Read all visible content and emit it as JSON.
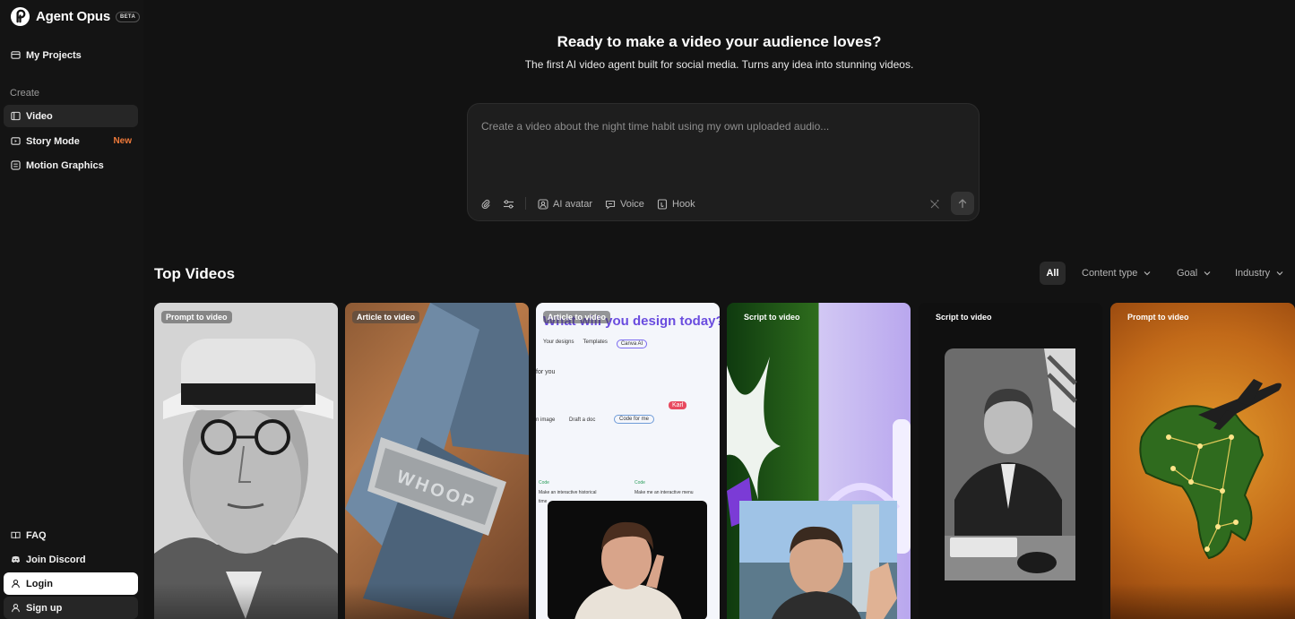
{
  "app": {
    "name": "Agent Opus",
    "beta_badge": "BETA"
  },
  "sidebar": {
    "my_projects": "My Projects",
    "section_create": "Create",
    "items": [
      {
        "label": "Video",
        "icon": "video-icon"
      },
      {
        "label": "Story Mode",
        "icon": "story-icon",
        "badge": "New"
      },
      {
        "label": "Motion Graphics",
        "icon": "motion-graphics-icon"
      }
    ],
    "bottom": [
      {
        "label": "FAQ",
        "icon": "book-icon"
      },
      {
        "label": "Join Discord",
        "icon": "discord-icon"
      },
      {
        "label": "Login",
        "icon": "user-icon"
      },
      {
        "label": "Sign up",
        "icon": "user-icon"
      }
    ]
  },
  "hero": {
    "title": "Ready to make a video your audience loves?",
    "subtitle": "The first AI video agent built for social media. Turns any idea into stunning videos."
  },
  "prompt": {
    "placeholder": "Create a video about the night time habit using my own uploaded audio...",
    "tools": {
      "ai_avatar": "AI avatar",
      "voice": "Voice",
      "hook": "Hook"
    }
  },
  "top_videos": {
    "title": "Top Videos",
    "filters": {
      "all": "All",
      "content_type": "Content type",
      "goal": "Goal",
      "industry": "Industry"
    },
    "cards": [
      {
        "tag": "Prompt to video"
      },
      {
        "tag": "Article to video",
        "brand_text": "WHOOP"
      },
      {
        "tag": "Article to video",
        "headline": "What will you design today?",
        "chips": [
          "Your designs",
          "Templates",
          "Canva AI"
        ],
        "label_for_you": "for you",
        "label_image": "n image",
        "label_doc": "Draft a doc",
        "label_code": "Code for me",
        "cursor_name": "Karl",
        "code_title": "Code",
        "code_1": "Make an interactive historical",
        "code_2": "Make me an interactive menu",
        "code_3": "time"
      },
      {
        "tag": "Script to video"
      },
      {
        "tag": "Script to video"
      },
      {
        "tag": "Prompt to video"
      }
    ]
  },
  "colors": {
    "background": "#121212",
    "accent_new": "#f07a3a"
  }
}
